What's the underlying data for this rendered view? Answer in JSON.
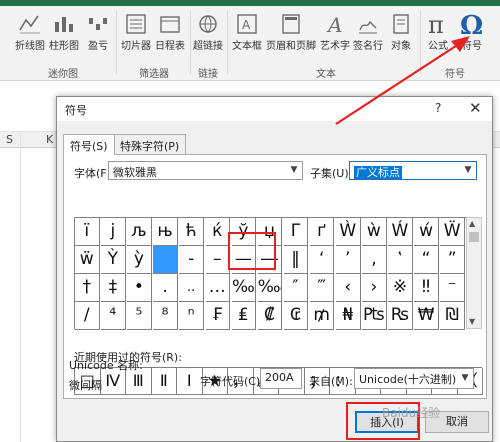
{
  "ribbon": {
    "buttons": [
      {
        "label": "折线图",
        "icon": "line-sparkline-icon"
      },
      {
        "label": "柱形图",
        "icon": "column-sparkline-icon"
      },
      {
        "label": "盈亏",
        "icon": "winloss-sparkline-icon"
      },
      {
        "label": "切片器",
        "icon": "slicer-icon"
      },
      {
        "label": "日程表",
        "icon": "timeline-icon"
      },
      {
        "label": "超链接",
        "icon": "hyperlink-icon"
      },
      {
        "label": "文本框",
        "icon": "textbox-icon"
      },
      {
        "label": "页眉和页脚",
        "icon": "header-footer-icon"
      },
      {
        "label": "艺术字",
        "icon": "wordart-icon"
      },
      {
        "label": "签名行",
        "icon": "signature-icon"
      },
      {
        "label": "对象",
        "icon": "object-icon"
      },
      {
        "label": "公式",
        "icon": "equation-icon"
      },
      {
        "label": "符号",
        "icon": "symbol-omega-icon"
      }
    ],
    "groups": {
      "sparklines": "迷你图",
      "filters": "筛选器",
      "links": "链接",
      "text": "文本",
      "symbols": "符号"
    }
  },
  "sheet": {
    "column_letters": [
      "K",
      "S"
    ]
  },
  "dialog": {
    "title": "符号",
    "help_glyph": "?",
    "close_glyph": "✕",
    "tabs": [
      "符号(S)",
      "特殊字符(P)"
    ],
    "font_label": "字体(F):",
    "font_value": "微软雅黑",
    "subset_label": "子集(U):",
    "subset_value": "广义标点",
    "symbol_rows": [
      [
        "ï",
        "j",
        "љ",
        "њ",
        "ћ",
        "ќ",
        "ў",
        "џ",
        "Γ",
        "ґ",
        "Ẁ",
        "ẁ",
        "Ẃ",
        "ẃ",
        "Ẅ"
      ],
      [
        "ẅ",
        "Ỳ",
        "ỳ",
        "",
        "-",
        "–",
        "—",
        "―",
        "‖",
        "‘",
        "’",
        "‚",
        "‛",
        "“",
        "”"
      ],
      [
        "†",
        "‡",
        "•",
        ".",
        "..",
        "…",
        "‰",
        "‱",
        "″",
        "‴",
        "‹",
        "›",
        "※",
        "‼",
        "⁻"
      ],
      [
        "/",
        "⁴",
        "⁵",
        "⁸",
        "ⁿ",
        "₣",
        "₤",
        "₡",
        "₢",
        "₥",
        "₦",
        "₧",
        "₨",
        "₩",
        "₪"
      ]
    ],
    "selected_symbol_index": [
      1,
      3
    ],
    "recent_label": "近期使用过的符号(R):",
    "recent_symbols": [
      "□",
      "Ⅳ",
      "Ⅲ",
      "Ⅱ",
      "Ⅰ",
      "★",
      "，",
      "。",
      "、",
      "；",
      "：",
      "！",
      "？",
      "“",
      "”",
      "（"
    ],
    "unicode_name_label": "Unicode 名称:",
    "unicode_name_value": "微间隔",
    "char_code_label": "字符代码(C):",
    "char_code_value": "200A",
    "from_label": "来自(M):",
    "from_value": "Unicode(十六进制)",
    "insert_label": "插入(I)",
    "cancel_label": "取消"
  },
  "watermark": "Baidu经验",
  "colors": {
    "ribbon_bg": "#f3f3f3",
    "dialog_bg": "#f0f0f0",
    "selection": "#3399ff",
    "subset_highlight": "#0078d7",
    "annotation_red": "#e5211f"
  }
}
